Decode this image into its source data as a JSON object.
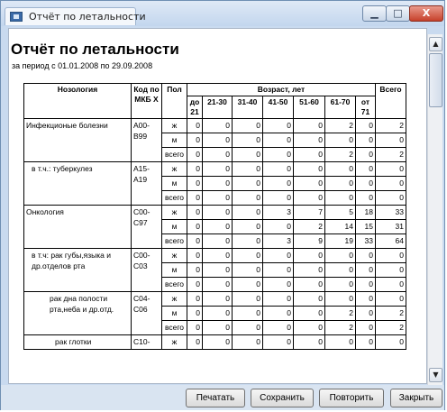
{
  "window": {
    "title": "Отчёт по летальности"
  },
  "report": {
    "title": "Отчёт по летальности",
    "period": "за период с 01.01.2008 по 29.09.2008",
    "headers": {
      "nosology": "Нозология",
      "code": "Код по МКБ Х",
      "sex": "Пол",
      "age": "Возраст, лет",
      "total": "Всего",
      "age_groups": [
        "до 21",
        "21-30",
        "31-40",
        "41-50",
        "51-60",
        "61-70",
        "от 71"
      ]
    },
    "groups": [
      {
        "name": "Инфекционые болезни",
        "code": "A00-B99",
        "rows": [
          {
            "sex": "ж",
            "values": [
              "0",
              "0",
              "0",
              "0",
              "0",
              "2",
              "0",
              "2"
            ]
          },
          {
            "sex": "м",
            "values": [
              "0",
              "0",
              "0",
              "0",
              "0",
              "0",
              "0",
              "0"
            ]
          },
          {
            "sex": "всего",
            "values": [
              "0",
              "0",
              "0",
              "0",
              "0",
              "2",
              "0",
              "2"
            ]
          }
        ]
      },
      {
        "name": "в т.ч.: туберкулез",
        "code": "A15-A19",
        "rows": [
          {
            "sex": "ж",
            "values": [
              "0",
              "0",
              "0",
              "0",
              "0",
              "0",
              "0",
              "0"
            ]
          },
          {
            "sex": "м",
            "values": [
              "0",
              "0",
              "0",
              "0",
              "0",
              "0",
              "0",
              "0"
            ]
          },
          {
            "sex": "всего",
            "values": [
              "0",
              "0",
              "0",
              "0",
              "0",
              "0",
              "0",
              "0"
            ]
          }
        ]
      },
      {
        "name": "Онкология",
        "code": "C00-C97",
        "rows": [
          {
            "sex": "ж",
            "values": [
              "0",
              "0",
              "0",
              "3",
              "7",
              "5",
              "18",
              "33"
            ]
          },
          {
            "sex": "м",
            "values": [
              "0",
              "0",
              "0",
              "0",
              "2",
              "14",
              "15",
              "31"
            ]
          },
          {
            "sex": "всего",
            "values": [
              "0",
              "0",
              "0",
              "3",
              "9",
              "19",
              "33",
              "64"
            ]
          }
        ]
      },
      {
        "name": "в т.ч: рак губы,языка и др.отделов рта",
        "code": "C00-C03",
        "rows": [
          {
            "sex": "ж",
            "values": [
              "0",
              "0",
              "0",
              "0",
              "0",
              "0",
              "0",
              "0"
            ]
          },
          {
            "sex": "м",
            "values": [
              "0",
              "0",
              "0",
              "0",
              "0",
              "0",
              "0",
              "0"
            ]
          },
          {
            "sex": "всего",
            "values": [
              "0",
              "0",
              "0",
              "0",
              "0",
              "0",
              "0",
              "0"
            ]
          }
        ]
      },
      {
        "name": "рак дна полости рта,неба и др.отд.",
        "code": "C04-C06",
        "rows": [
          {
            "sex": "ж",
            "values": [
              "0",
              "0",
              "0",
              "0",
              "0",
              "0",
              "0",
              "0"
            ]
          },
          {
            "sex": "м",
            "values": [
              "0",
              "0",
              "0",
              "0",
              "0",
              "2",
              "0",
              "2"
            ]
          },
          {
            "sex": "всего",
            "values": [
              "0",
              "0",
              "0",
              "0",
              "0",
              "2",
              "0",
              "2"
            ]
          }
        ]
      },
      {
        "name": "рак глотки",
        "code": "C10-",
        "rows": [
          {
            "sex": "ж",
            "values": [
              "0",
              "0",
              "0",
              "0",
              "0",
              "0",
              "0",
              "0"
            ]
          }
        ]
      }
    ]
  },
  "buttons": {
    "print": "Печатать",
    "save": "Сохранить",
    "repeat": "Повторить",
    "close": "Закрыть"
  },
  "titlebar_buttons": {
    "minimize": "▁",
    "maximize": "□",
    "close": "X"
  },
  "scrollbar": {
    "up": "▲",
    "down": "▼"
  },
  "colors": {
    "title_bar": "#c9daef",
    "close_button": "#c7412b",
    "button_bar": "#d9e4f1"
  }
}
